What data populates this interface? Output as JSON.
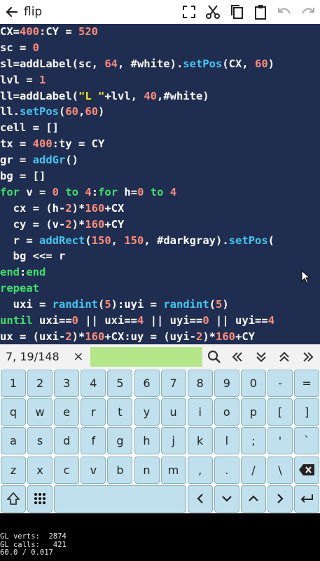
{
  "app": {
    "title": "flip"
  },
  "toolbar": {
    "icons": [
      "fullscreen-icon",
      "cut-icon",
      "copy-icon",
      "paste-icon",
      "undo-icon",
      "redo-icon"
    ]
  },
  "colors": {
    "editor_bg": "#1f2d50",
    "keyword": "#3fe06b",
    "function": "#45c6f2",
    "number": "#ff8d7a",
    "string": "#ffe600",
    "search_bg": "#b5e68a",
    "key_bg": "#bfe0ec"
  },
  "code": [
    [
      [
        "pl",
        "CX="
      ],
      [
        "num",
        "400"
      ],
      [
        "pl",
        ":CY = "
      ],
      [
        "num",
        "520"
      ]
    ],
    [
      [
        "pl",
        "sc = "
      ],
      [
        "num",
        "0"
      ]
    ],
    [
      [
        "pl",
        "sl=addLabel(sc, "
      ],
      [
        "num",
        "64"
      ],
      [
        "pl",
        ", #white)."
      ],
      [
        "fn",
        "setPos"
      ],
      [
        "pl",
        "(CX, "
      ],
      [
        "num",
        "60"
      ],
      [
        "pl",
        ")"
      ]
    ],
    [
      [
        "pl",
        "lvl = "
      ],
      [
        "num",
        "1"
      ]
    ],
    [
      [
        "pl",
        "ll=addLabel("
      ],
      [
        "str",
        "\"L \""
      ],
      [
        "pl",
        "+lvl, "
      ],
      [
        "num",
        "40"
      ],
      [
        "pl",
        ",#white)"
      ]
    ],
    [
      [
        "pl",
        "ll."
      ],
      [
        "fn",
        "setPos"
      ],
      [
        "pl",
        "("
      ],
      [
        "num",
        "60"
      ],
      [
        "pl",
        ","
      ],
      [
        "num",
        "60"
      ],
      [
        "pl",
        ")"
      ]
    ],
    [
      [
        "pl",
        "cell = []"
      ]
    ],
    [
      [
        "pl",
        "tx = "
      ],
      [
        "num",
        "400"
      ],
      [
        "pl",
        ":ty = CY"
      ]
    ],
    [
      [
        "pl",
        "gr = "
      ],
      [
        "fn",
        "addGr"
      ],
      [
        "pl",
        "()"
      ]
    ],
    [
      [
        "pl",
        "bg = []"
      ]
    ],
    [
      [
        "kw",
        "for"
      ],
      [
        "pl",
        " v = "
      ],
      [
        "num",
        "0"
      ],
      [
        "pl",
        " "
      ],
      [
        "kw",
        "to"
      ],
      [
        "pl",
        " "
      ],
      [
        "num",
        "4"
      ],
      [
        "pl",
        ":"
      ],
      [
        "kw",
        "for"
      ],
      [
        "pl",
        " h="
      ],
      [
        "num",
        "0"
      ],
      [
        "pl",
        " "
      ],
      [
        "kw",
        "to"
      ],
      [
        "pl",
        " "
      ],
      [
        "num",
        "4"
      ]
    ],
    [
      [
        "pl",
        "  cx = (h-"
      ],
      [
        "num",
        "2"
      ],
      [
        "pl",
        ")*"
      ],
      [
        "num",
        "160"
      ],
      [
        "pl",
        "+CX"
      ]
    ],
    [
      [
        "pl",
        "  cy = (v-"
      ],
      [
        "num",
        "2"
      ],
      [
        "pl",
        ")*"
      ],
      [
        "num",
        "160"
      ],
      [
        "pl",
        "+CY"
      ]
    ],
    [
      [
        "pl",
        "  r = "
      ],
      [
        "fn",
        "addRect"
      ],
      [
        "pl",
        "("
      ],
      [
        "num",
        "150"
      ],
      [
        "pl",
        ", "
      ],
      [
        "num",
        "150"
      ],
      [
        "pl",
        ", #darkgray)."
      ],
      [
        "fn",
        "setPos"
      ],
      [
        "pl",
        "("
      ]
    ],
    [
      [
        "pl",
        "  bg <<= r"
      ]
    ],
    [
      [
        "kw",
        "end"
      ],
      [
        "pl",
        ":"
      ],
      [
        "kw",
        "end"
      ]
    ],
    [
      [
        "kw",
        "repeat"
      ]
    ],
    [
      [
        "pl",
        "  uxi = "
      ],
      [
        "fn",
        "randint"
      ],
      [
        "pl",
        "("
      ],
      [
        "num",
        "5"
      ],
      [
        "pl",
        "):uyi = "
      ],
      [
        "fn",
        "randint"
      ],
      [
        "pl",
        "("
      ],
      [
        "num",
        "5"
      ],
      [
        "pl",
        ")"
      ]
    ],
    [
      [
        "kw",
        "until"
      ],
      [
        "pl",
        " uxi=="
      ],
      [
        "num",
        "0"
      ],
      [
        "pl",
        " || uxi=="
      ],
      [
        "num",
        "4"
      ],
      [
        "pl",
        " || uyi=="
      ],
      [
        "num",
        "0"
      ],
      [
        "pl",
        " || uyi=="
      ],
      [
        "num",
        "4"
      ]
    ],
    [
      [
        "pl",
        "ux = (uxi-"
      ],
      [
        "num",
        "2"
      ],
      [
        "pl",
        ")*"
      ],
      [
        "num",
        "160"
      ],
      [
        "pl",
        "+CX:uy = (uyi-"
      ],
      [
        "num",
        "2"
      ],
      [
        "pl",
        ")*"
      ],
      [
        "num",
        "160"
      ],
      [
        "pl",
        "+CY"
      ]
    ]
  ],
  "status": {
    "position": "7, 19/148",
    "clear_label": "×"
  },
  "search": {
    "value": ""
  },
  "keyboard": {
    "rows": [
      [
        "1",
        "2",
        "3",
        "4",
        "5",
        "6",
        "7",
        "8",
        "9",
        "0",
        "-",
        "="
      ],
      [
        "q",
        "w",
        "e",
        "r",
        "t",
        "y",
        "u",
        "i",
        "o",
        "p",
        "[",
        "]"
      ],
      [
        "a",
        "s",
        "d",
        "f",
        "g",
        "h",
        "j",
        "k",
        "l",
        ";",
        "'",
        "`"
      ],
      [
        "z",
        "x",
        "c",
        "v",
        "b",
        "n",
        "m",
        ",",
        ".",
        "/",
        "\\",
        "⌫"
      ],
      [
        "⇧",
        "⠿",
        "",
        "",
        "",
        "",
        "",
        "<",
        "∨",
        "∧",
        ">",
        "↵"
      ]
    ]
  },
  "debug": {
    "gl_verts_label": "GL verts:",
    "gl_verts": "2874",
    "gl_calls_label": "GL calls:",
    "gl_calls": "421",
    "fps_line": "60.0 / 0.017"
  }
}
